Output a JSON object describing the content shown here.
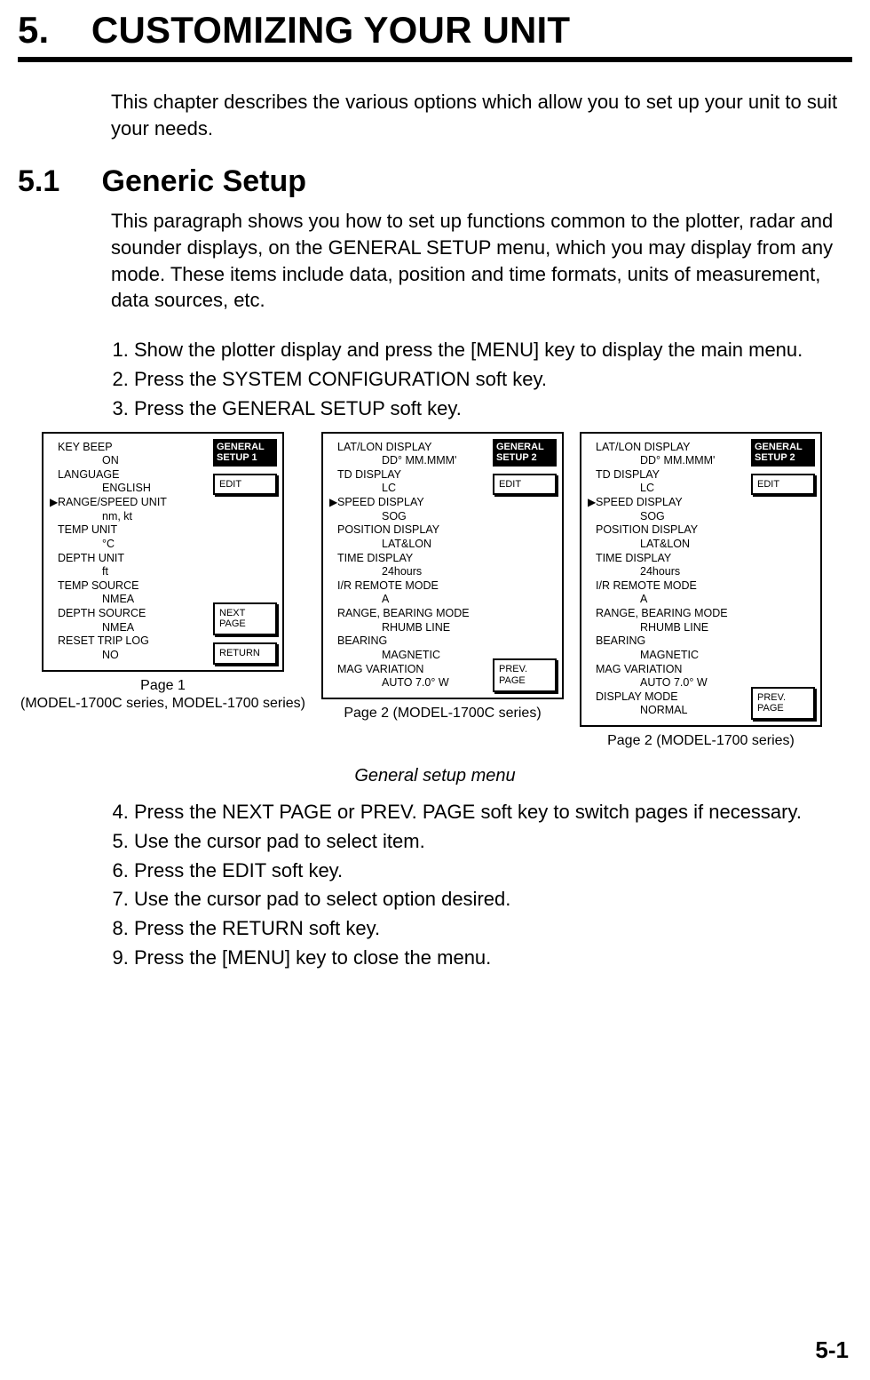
{
  "chapter_number": "5.",
  "chapter_title": "CUSTOMIZING YOUR UNIT",
  "intro_paragraph": "This chapter describes the various options which allow you to set up your unit to suit your needs.",
  "section_number": "5.1",
  "section_title": "Generic Setup",
  "section_paragraph": "This paragraph shows you how to set up functions common to the plotter, radar and sounder displays, on the GENERAL SETUP menu, which you may display from any mode. These items include data, position and time formats, units of measurement, data sources, etc.",
  "steps_a": [
    "Show the plotter display and press the [MENU] key to display the main menu.",
    "Press the SYSTEM CONFIGURATION soft key.",
    "Press the GENERAL SETUP soft key."
  ],
  "screen1": {
    "title_line1": "GENERAL",
    "title_line2": "SETUP 1",
    "edit": "EDIT",
    "next_line1": "NEXT",
    "next_line2": "PAGE",
    "return": "RETURN",
    "cursor_row": 2,
    "items": [
      {
        "label": "KEY BEEP",
        "value": "ON"
      },
      {
        "label": "LANGUAGE",
        "value": "ENGLISH"
      },
      {
        "label": "RANGE/SPEED UNIT",
        "value": "nm, kt"
      },
      {
        "label": "TEMP UNIT",
        "value": "°C"
      },
      {
        "label": "DEPTH UNIT",
        "value": "ft"
      },
      {
        "label": "TEMP SOURCE",
        "value": "NMEA"
      },
      {
        "label": "DEPTH SOURCE",
        "value": "NMEA"
      },
      {
        "label": "RESET TRIP LOG",
        "value": "NO"
      }
    ],
    "caption_line1": "Page 1",
    "caption_line2": "(MODEL-1700C series, MODEL-1700 series)"
  },
  "screen2": {
    "title_line1": "GENERAL",
    "title_line2": "SETUP 2",
    "edit": "EDIT",
    "prev_line1": "PREV.",
    "prev_line2": "PAGE",
    "cursor_row": 2,
    "items": [
      {
        "label": "LAT/LON DISPLAY",
        "value": "DD° MM.MMM'"
      },
      {
        "label": "TD DISPLAY",
        "value": "LC"
      },
      {
        "label": "SPEED DISPLAY",
        "value": "SOG"
      },
      {
        "label": "POSITION DISPLAY",
        "value": "LAT&LON"
      },
      {
        "label": "TIME DISPLAY",
        "value": "24hours"
      },
      {
        "label": "I/R REMOTE MODE",
        "value": "A"
      },
      {
        "label": "RANGE, BEARING MODE",
        "value": "RHUMB LINE"
      },
      {
        "label": "BEARING",
        "value": "MAGNETIC"
      },
      {
        "label": "MAG VARIATION",
        "value": "AUTO 7.0° W"
      }
    ],
    "caption": "Page 2 (MODEL-1700C series)"
  },
  "screen3": {
    "title_line1": "GENERAL",
    "title_line2": "SETUP 2",
    "edit": "EDIT",
    "prev_line1": "PREV.",
    "prev_line2": "PAGE",
    "cursor_row": 2,
    "items": [
      {
        "label": "LAT/LON DISPLAY",
        "value": "DD° MM.MMM'"
      },
      {
        "label": "TD DISPLAY",
        "value": "LC"
      },
      {
        "label": "SPEED DISPLAY",
        "value": "SOG"
      },
      {
        "label": "POSITION DISPLAY",
        "value": "LAT&LON"
      },
      {
        "label": "TIME DISPLAY",
        "value": "24hours"
      },
      {
        "label": "I/R REMOTE MODE",
        "value": "A"
      },
      {
        "label": "RANGE, BEARING MODE",
        "value": "RHUMB LINE"
      },
      {
        "label": "BEARING",
        "value": "MAGNETIC"
      },
      {
        "label": "MAG VARIATION",
        "value": "AUTO 7.0° W"
      },
      {
        "label": "DISPLAY MODE",
        "value": "NORMAL"
      }
    ],
    "caption": "Page 2 (MODEL-1700 series)"
  },
  "figure_caption": "General setup menu",
  "steps_b": [
    "Press the NEXT PAGE or PREV. PAGE soft key to switch pages if necessary.",
    "Use the cursor pad to select item.",
    "Press the EDIT soft key.",
    "Use the cursor pad to select option desired.",
    "Press the RETURN soft key.",
    "Press the [MENU] key to close the menu."
  ],
  "page_number": "5-1",
  "cursor_glyph": "▶"
}
